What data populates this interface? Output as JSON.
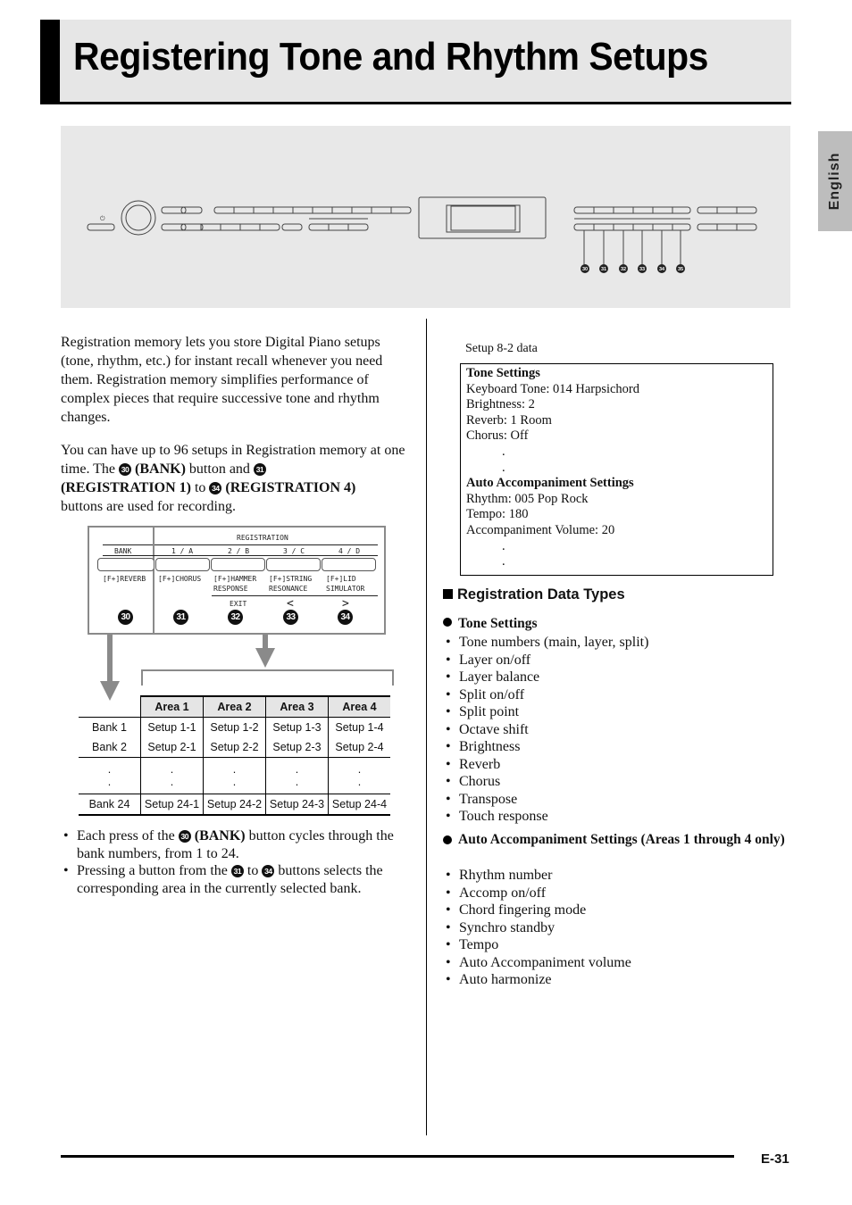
{
  "title": "Registering Tone and Rhythm Setups",
  "language_tab": "English",
  "panel": {
    "callouts": [
      "30",
      "31",
      "32",
      "33",
      "34",
      "35"
    ]
  },
  "intro": {
    "p1": "Registration memory lets you store Digital Piano setups (tone, rhythm, etc.) for instant recall whenever you need them. Registration memory simplifies performance of complex pieces that require successive tone and rhythm changes.",
    "p2_a": "You can have up to 96 setups in Registration memory at one time. The ",
    "p2_n1": "30",
    "p2_b": " (BANK)",
    "p2_c": " button and ",
    "p2_n2": "31",
    "p2_d": "(REGISTRATION 1)",
    "p2_e": " to ",
    "p2_n3": "34",
    "p2_f": " (REGISTRATION 4)",
    "p2_g": "buttons are used for recording."
  },
  "diagram": {
    "registration_label": "REGISTRATION",
    "columns": [
      {
        "header": "BANK",
        "function": "[F+]REVERB",
        "function2": "",
        "sub": "",
        "num": "30"
      },
      {
        "header": "1 / A",
        "function": "[F+]CHORUS",
        "function2": "",
        "sub": "",
        "num": "31"
      },
      {
        "header": "2 / B",
        "function": "[F+]HAMMER",
        "function2": "RESPONSE",
        "sub": "EXIT",
        "num": "32"
      },
      {
        "header": "3 / C",
        "function": "[F+]STRING",
        "function2": "RESONANCE",
        "sub": "<",
        "num": "33"
      },
      {
        "header": "4 / D",
        "function": "[F+]LID",
        "function2": "SIMULATOR",
        "sub": ">",
        "num": "34"
      }
    ]
  },
  "bank_table": {
    "headers": [
      "Area 1",
      "Area 2",
      "Area 3",
      "Area 4"
    ],
    "rows": [
      {
        "bank": "Bank 1",
        "cells": [
          "Setup 1-1",
          "Setup 1-2",
          "Setup 1-3",
          "Setup 1-4"
        ]
      },
      {
        "bank": "Bank 2",
        "cells": [
          "Setup 2-1",
          "Setup 2-2",
          "Setup 2-3",
          "Setup 2-4"
        ]
      },
      {
        "bank": ".\n.",
        "cells": [
          ".\n.",
          ".\n.",
          ".\n.",
          ".\n."
        ]
      },
      {
        "bank": "Bank 24",
        "cells": [
          "Setup 24-1",
          "Setup 24-2",
          "Setup 24-3",
          "Setup 24-4"
        ]
      }
    ]
  },
  "notes": {
    "n1_a": "Each press of the ",
    "n1_num": "30",
    "n1_b": " (BANK)",
    "n1_c": " button cycles through the bank numbers, from 1 to 24.",
    "n2_a": "Pressing a button from the ",
    "n2_num1": "31",
    "n2_b": " to ",
    "n2_num2": "34",
    "n2_c": " buttons selects the corresponding area in the currently selected bank."
  },
  "setup_box": {
    "caption": "Setup 8-2 data",
    "tone_heading": "Tone Settings",
    "tone_lines": [
      "Keyboard Tone: 014 Harpsichord",
      "Brightness: 2",
      "Reverb: 1 Room",
      "Chorus: Off"
    ],
    "accomp_heading": "Auto Accompaniment Settings",
    "accomp_lines": [
      "Rhythm: 005 Pop Rock",
      "Tempo: 180",
      "Accompaniment Volume: 20"
    ],
    "ellipsis": "."
  },
  "data_types": {
    "heading": "Registration Data Types",
    "tone_heading": "Tone Settings",
    "tone_items": [
      "Tone numbers (main, layer, split)",
      "Layer on/off",
      "Layer balance",
      "Split on/off",
      "Split point",
      "Octave shift",
      "Brightness",
      "Reverb",
      "Chorus",
      "Transpose",
      "Touch response"
    ],
    "accomp_heading": "Auto Accompaniment Settings (Areas 1 through 4 only)",
    "accomp_items": [
      "Rhythm number",
      "Accomp on/off",
      "Chord fingering mode",
      "Synchro standby",
      "Tempo",
      "Auto Accompaniment volume",
      "Auto harmonize"
    ]
  },
  "page_number": "E-31"
}
